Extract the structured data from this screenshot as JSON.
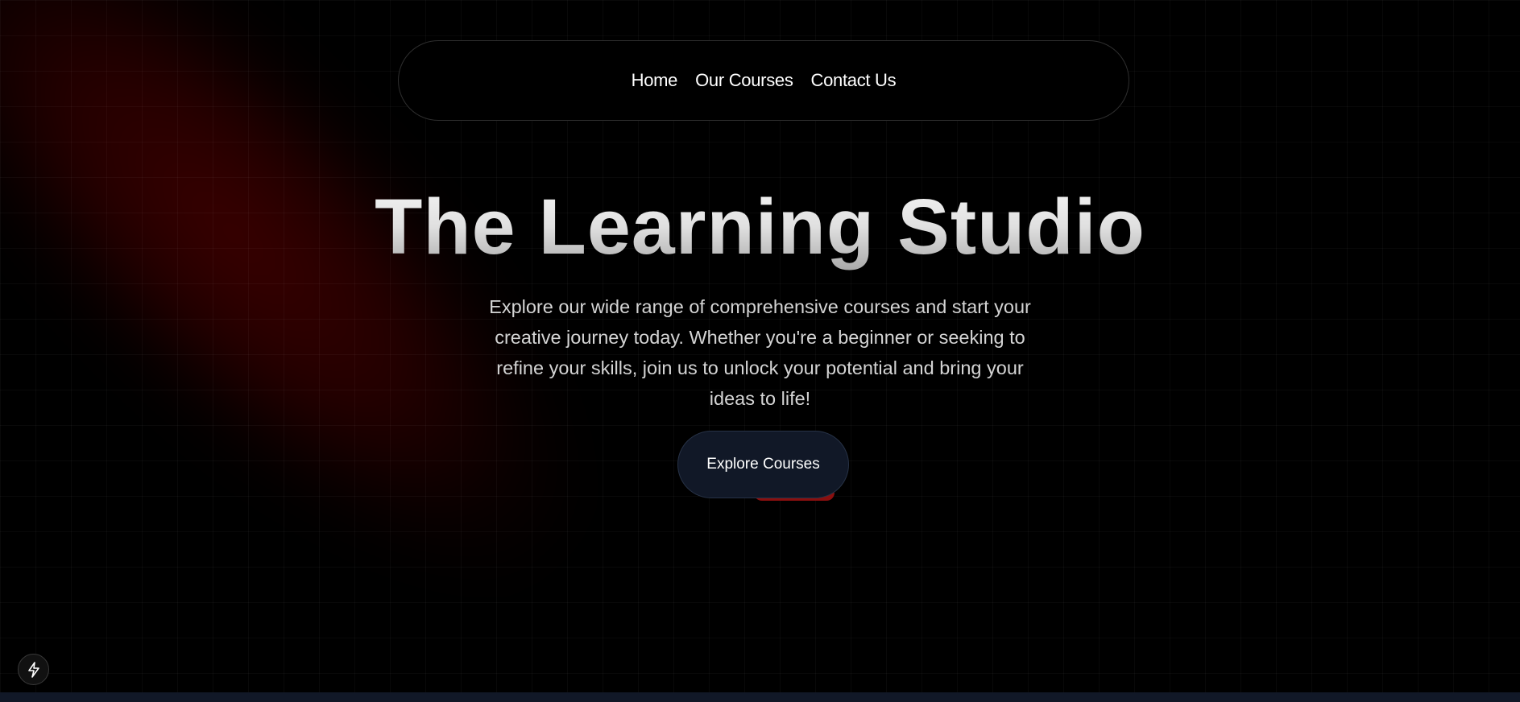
{
  "nav": {
    "items": [
      {
        "label": "Home"
      },
      {
        "label": "Our Courses"
      },
      {
        "label": "Contact Us"
      }
    ]
  },
  "hero": {
    "title": "The Learning Studio",
    "description": "Explore our wide range of comprehensive courses and start your creative journey today. Whether you're a beginner or seeking to refine your skills, join us to unlock your potential and bring your ideas to life!",
    "cta_label": "Explore Courses"
  },
  "icons": {
    "dev_tool": "lightning-bolt-icon"
  },
  "colors": {
    "background": "#000000",
    "glow": "#300000",
    "button_bg": "#111827",
    "accent_red": "#8a0f0f"
  }
}
